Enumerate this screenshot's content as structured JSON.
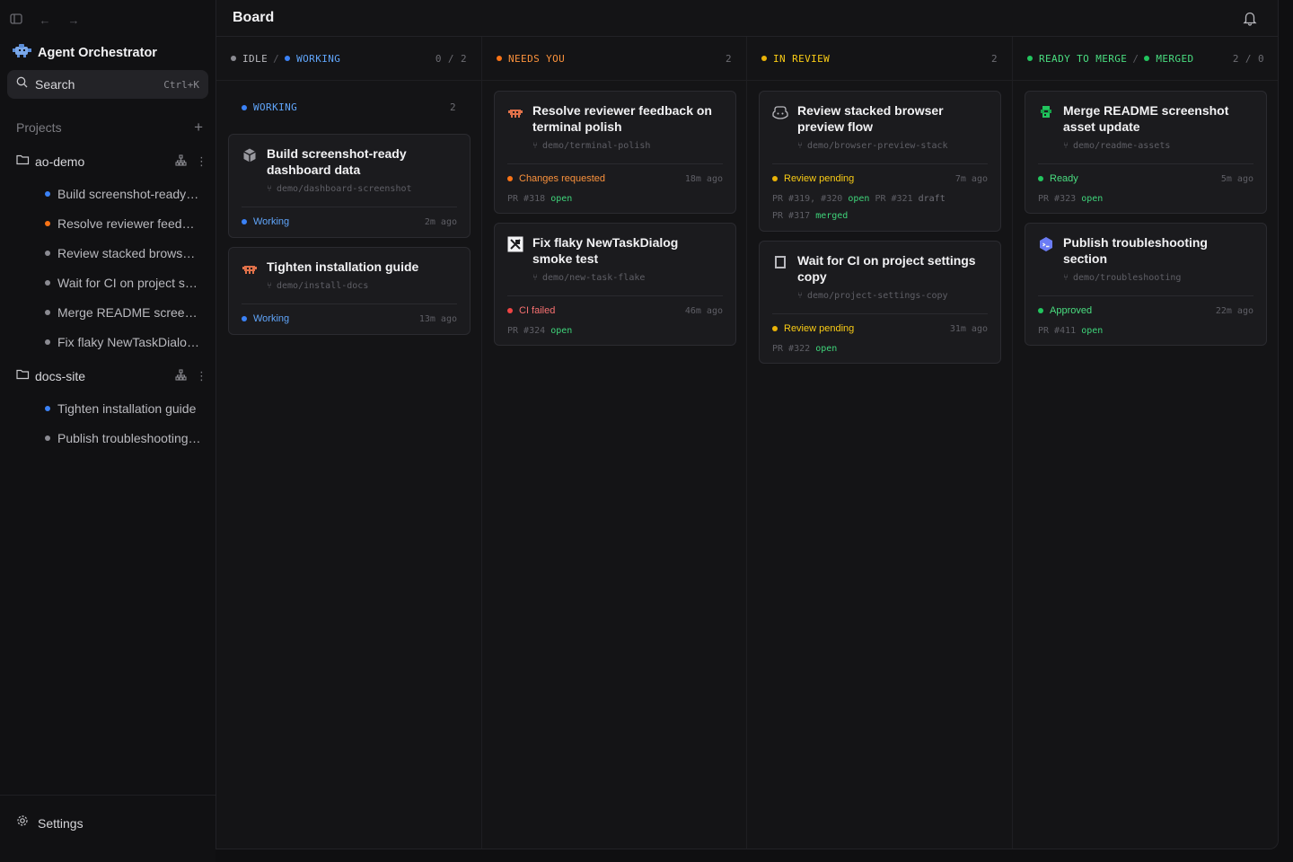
{
  "app": {
    "title": "Agent Orchestrator"
  },
  "search": {
    "label": "Search",
    "shortcut": "Ctrl+K"
  },
  "projects": {
    "label": "Projects",
    "items": [
      {
        "name": "ao-demo",
        "sessions": [
          {
            "title": "Build screenshot-ready dashboard data",
            "color": "#3b82f6"
          },
          {
            "title": "Resolve reviewer feedback on terminal polish",
            "color": "#f97316"
          },
          {
            "title": "Review stacked browser preview flow",
            "color": "#8b8b92"
          },
          {
            "title": "Wait for CI on project settings copy",
            "color": "#8b8b92"
          },
          {
            "title": "Merge README screenshot asset update",
            "color": "#8b8b92"
          },
          {
            "title": "Fix flaky NewTaskDialog smoke test",
            "color": "#8b8b92"
          }
        ]
      },
      {
        "name": "docs-site",
        "sessions": [
          {
            "title": "Tighten installation guide",
            "color": "#3b82f6"
          },
          {
            "title": "Publish troubleshooting section",
            "color": "#8b8b92"
          }
        ]
      }
    ]
  },
  "settings": {
    "label": "Settings"
  },
  "board": {
    "title": "Board",
    "columns": [
      {
        "labels": [
          "IDLE",
          "WORKING"
        ],
        "colors": [
          "#8b8b92",
          "#3b82f6"
        ],
        "text_colors": [
          "#b9b9be",
          "#60a5fa"
        ],
        "count": "0 / 2",
        "sub": {
          "label": "WORKING",
          "count": "2"
        }
      },
      {
        "labels": [
          "NEEDS YOU"
        ],
        "colors": [
          "#f97316"
        ],
        "text_colors": [
          "#fb923c"
        ],
        "count": "2"
      },
      {
        "labels": [
          "IN REVIEW"
        ],
        "colors": [
          "#eab308"
        ],
        "text_colors": [
          "#facc15"
        ],
        "count": "2"
      },
      {
        "labels": [
          "READY TO MERGE",
          "MERGED"
        ],
        "colors": [
          "#22c55e",
          "#22c55e"
        ],
        "text_colors": [
          "#4ade80",
          "#4ade80"
        ],
        "count": "2 / 0"
      }
    ]
  },
  "cards": {
    "c1": {
      "title": "Build screenshot-ready dashboard data",
      "branch": "demo/dashboard-screenshot",
      "status": "Working",
      "ago": "2m ago",
      "icon": "cube-icon"
    },
    "c2": {
      "title": "Tighten installation guide",
      "branch": "demo/install-docs",
      "status": "Working",
      "ago": "13m ago",
      "icon": "crab-icon"
    },
    "c3": {
      "title": "Resolve reviewer feedback on terminal polish",
      "branch": "demo/terminal-polish",
      "status": "Changes requested",
      "ago": "18m ago",
      "pr": "PR #318",
      "pr_state": "open",
      "icon": "crab-icon"
    },
    "c4": {
      "title": "Fix flaky NewTaskDialog smoke test",
      "branch": "demo/new-task-flake",
      "status": "CI failed",
      "ago": "46m ago",
      "pr": "PR #324",
      "pr_state": "open",
      "icon": "cursor-logo-icon"
    },
    "c5": {
      "title": "Review stacked browser preview flow",
      "branch": "demo/browser-preview-stack",
      "status": "Review pending",
      "ago": "7m ago",
      "pr_a": "PR #319, #320",
      "pr_a_state": "open",
      "pr_b": "PR #321",
      "pr_b_state": "draft",
      "pr_c": "PR #317",
      "pr_c_state": "merged",
      "icon": "copilot-icon"
    },
    "c6": {
      "title": "Wait for CI on project settings copy",
      "branch": "demo/project-settings-copy",
      "status": "Review pending",
      "ago": "31m ago",
      "pr": "PR #322",
      "pr_state": "open",
      "icon": "square-icon"
    },
    "c7": {
      "title": "Merge README screenshot asset update",
      "branch": "demo/readme-assets",
      "status": "Ready",
      "ago": "5m ago",
      "pr": "PR #323",
      "pr_state": "open",
      "icon": "green-agent-icon"
    },
    "c8": {
      "title": "Publish troubleshooting section",
      "branch": "demo/troubleshooting",
      "status": "Approved",
      "ago": "22m ago",
      "pr": "PR #411",
      "pr_state": "open",
      "icon": "blue-agent-icon"
    }
  },
  "colors": {
    "working": "#3b82f6",
    "working_text": "#60a5fa",
    "changes": "#f97316",
    "failed": "#ef4444",
    "pending": "#eab308",
    "ready": "#22c55e"
  }
}
